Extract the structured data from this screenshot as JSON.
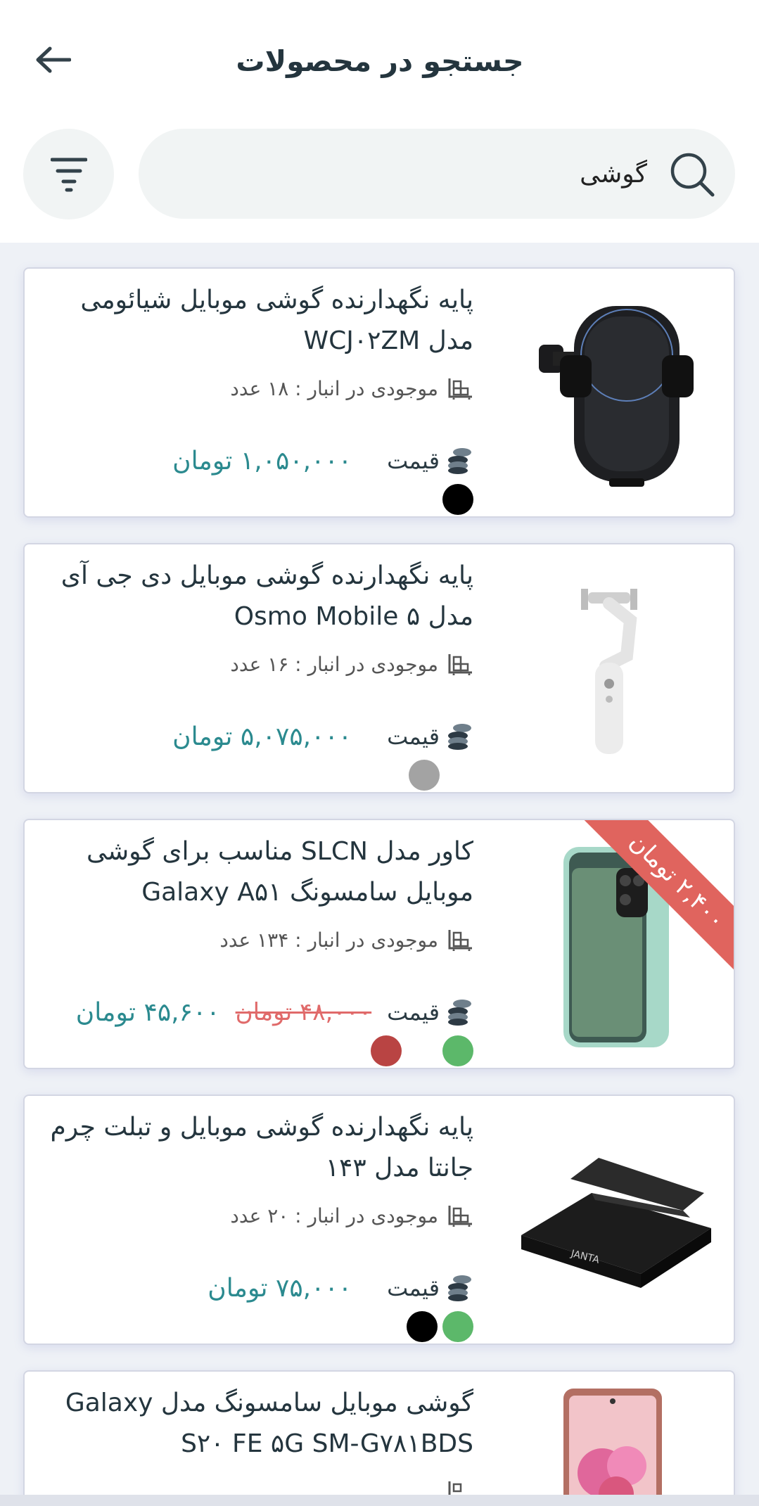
{
  "header": {
    "title": "جستجو در محصولات",
    "back_icon": "arrow-left-icon",
    "search_value": "گوشی",
    "search_icon": "search-icon",
    "filter_icon": "filter-icon"
  },
  "labels": {
    "price": "قیمت",
    "stock_icon": "warehouse-icon",
    "price_icon": "coins-icon"
  },
  "colors": {
    "accent": "#2b8a8f",
    "discount": "#e0645e",
    "title": "#24353e"
  },
  "products": [
    {
      "title": "پایه نگهدارنده گوشی موبایل شیائومی مدل WCJ۰۲ZM",
      "stock": "موجودی در انبار : ۱۸ عدد",
      "price": "۱,۰۵۰,۰۰۰ تومان",
      "image": "phone-car-mount",
      "swatches": [
        "#000000"
      ]
    },
    {
      "title": "پایه نگهدارنده گوشی موبایل دی جی آی مدل Osmo Mobile ۵",
      "stock": "موجودی در انبار : ۱۶ عدد",
      "price": "۵,۰۷۵,۰۰۰ تومان",
      "image": "gimbal-stabilizer",
      "swatches": [
        "#a3a3a3"
      ]
    },
    {
      "title": "کاور مدل SLCN مناسب برای گوشی موبایل سامسونگ Galaxy A۵۱",
      "stock": "موجودی در انبار : ۱۳۴ عدد",
      "price": "۴۵,۶۰۰ تومان",
      "old_price": "۴۸,۰۰۰ تومان",
      "discount": "۲,۴۰۰ تومان",
      "image": "phone-case",
      "swatches": [
        "#5cb86a",
        "#b94443"
      ]
    },
    {
      "title": "پایه نگهدارنده گوشی موبایل و تبلت چرم جانتا مدل ۱۴۳",
      "stock": "موجودی در انبار : ۲۰ عدد",
      "price": "۷۵,۰۰۰ تومان",
      "image": "leather-stand",
      "brand_text": "JANTA",
      "swatches": [
        "#5cb86a",
        "#000000"
      ]
    },
    {
      "title": "گوشی موبایل سامسونگ مدل Galaxy S۲۰ FE ۵G SM-G۷۸۱BDS",
      "image": "samsung-phone"
    }
  ]
}
